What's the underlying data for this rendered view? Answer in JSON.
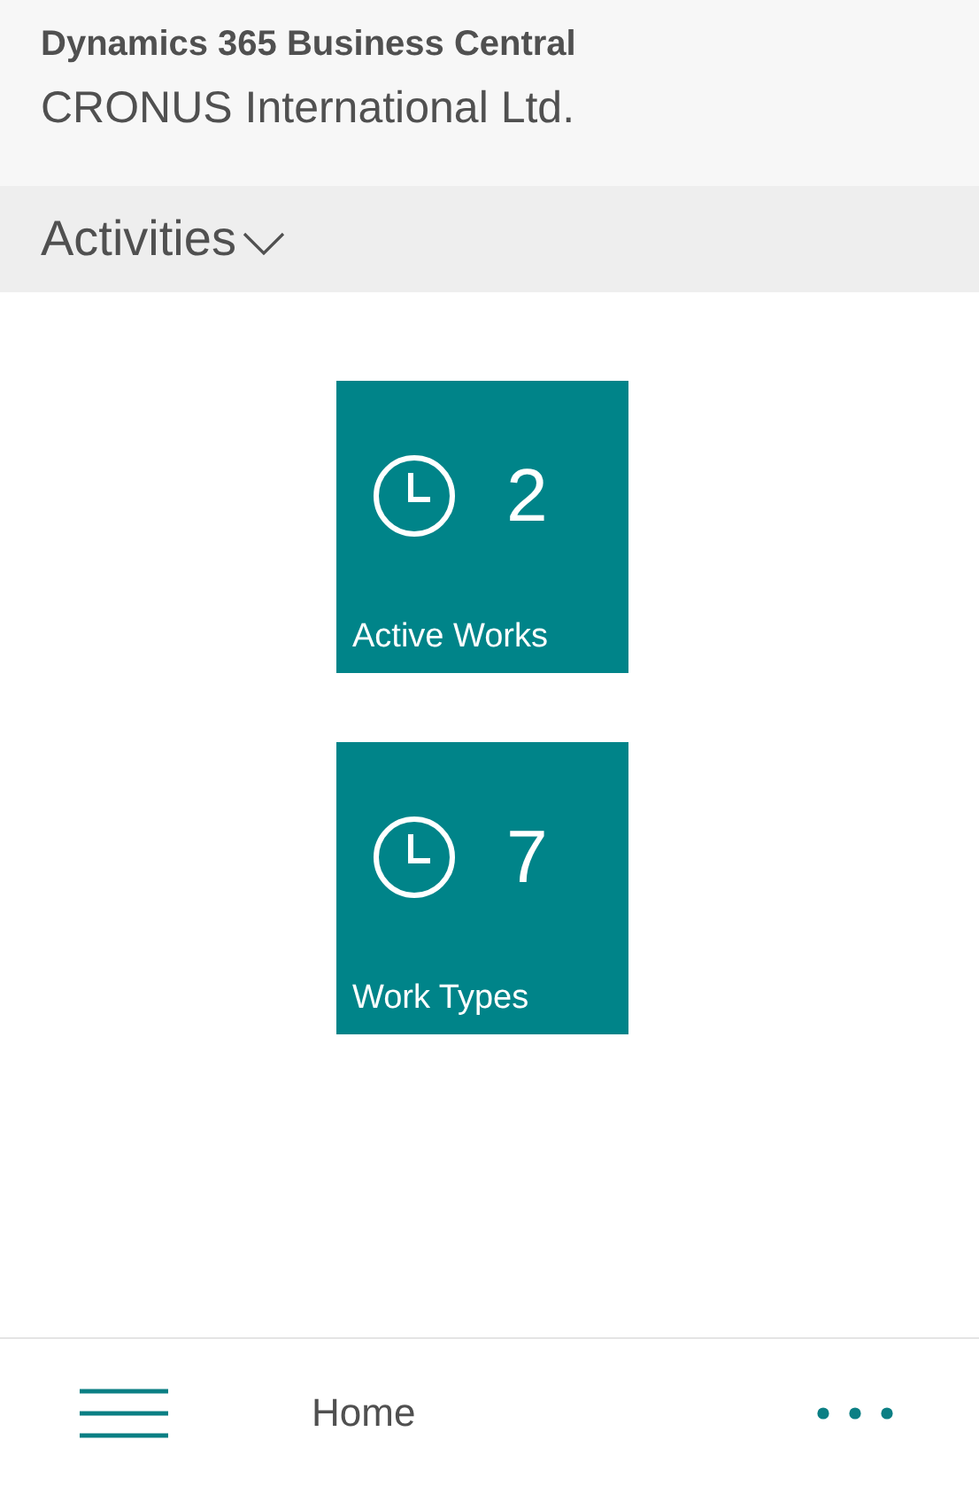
{
  "header": {
    "product": "Dynamics 365 Business Central",
    "company": "CRONUS International Ltd."
  },
  "section": {
    "title": "Activities",
    "expanded": true
  },
  "tiles": [
    {
      "value": "2",
      "label": "Active Works"
    },
    {
      "value": "7",
      "label": "Work Types"
    }
  ],
  "bottom_bar": {
    "label": "Home"
  }
}
